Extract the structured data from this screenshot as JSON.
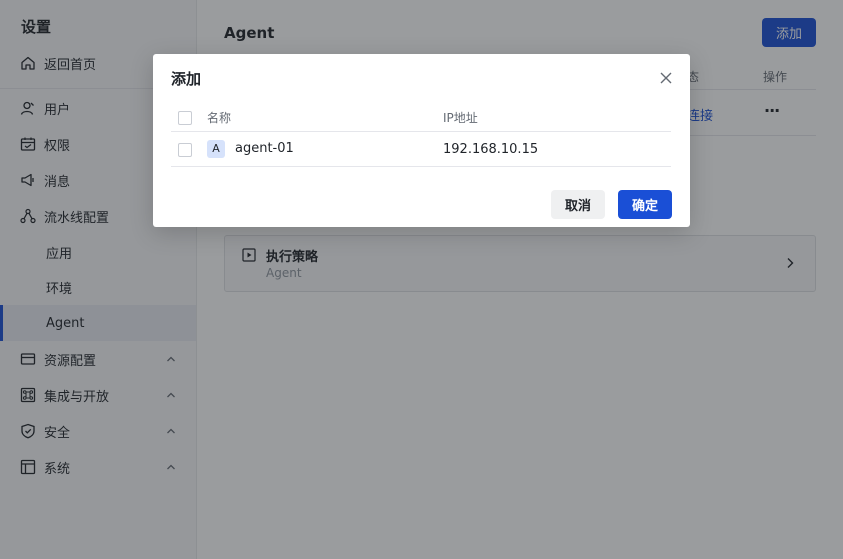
{
  "sidebar": {
    "title": "设置",
    "items": [
      {
        "label": "返回首页",
        "icon": "home-icon"
      },
      {
        "label": "用户",
        "icon": "user-icon"
      },
      {
        "label": "权限",
        "icon": "calendar-icon"
      },
      {
        "label": "消息",
        "icon": "megaphone-icon"
      },
      {
        "label": "流水线配置",
        "icon": "pipeline-icon"
      },
      {
        "label": "应用"
      },
      {
        "label": "环境"
      },
      {
        "label": "Agent",
        "active": true
      },
      {
        "label": "资源配置",
        "icon": "card-icon"
      },
      {
        "label": "集成与开放",
        "icon": "command-icon"
      },
      {
        "label": "安全",
        "icon": "shield-icon"
      },
      {
        "label": "系统",
        "icon": "layout-icon"
      }
    ]
  },
  "main": {
    "title": "Agent",
    "add_button": "添加",
    "table_headers": {
      "status": "态",
      "ops": "操作"
    },
    "row": {
      "status": "连接",
      "more": "···"
    },
    "policy_card": {
      "title": "执行策略",
      "subtitle": "Agent"
    }
  },
  "modal": {
    "title": "添加",
    "columns": {
      "name": "名称",
      "ip": "IP地址"
    },
    "rows": [
      {
        "avatar": "A",
        "name": "agent-01",
        "ip": "192.168.10.15"
      }
    ],
    "cancel_label": "取消",
    "confirm_label": "确定"
  },
  "colors": {
    "accent": "#1a4fd6",
    "mask": "rgba(31,35,41,0.45)"
  }
}
